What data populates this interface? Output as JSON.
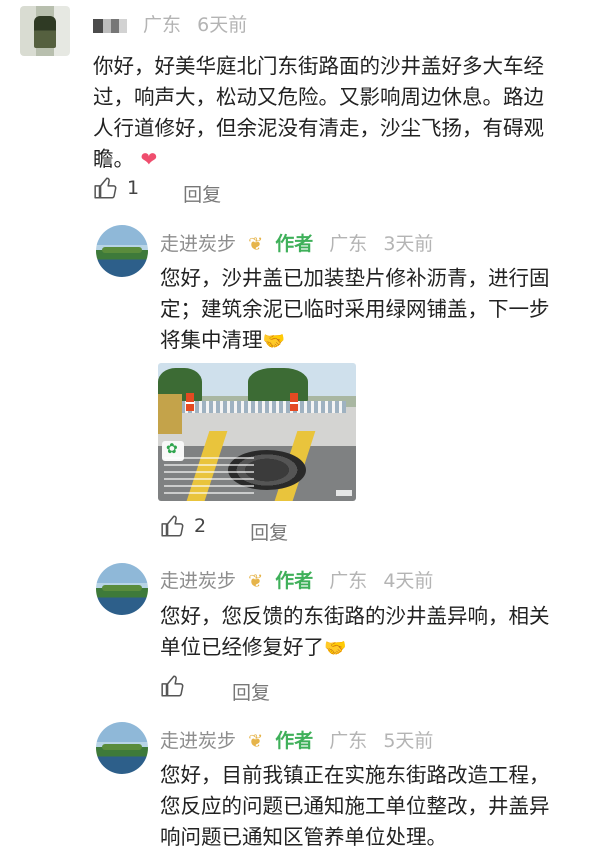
{
  "comments": [
    {
      "name": "",
      "region": "广东",
      "time": "6天前",
      "text_lines": [
        "你好，好美华庭北门东街路面的沙井盖好多大车经",
        "过，响声大，松动又危险。又影响周边休息。路边",
        "人行道修好，但余泥没有清走，沙尘飞扬，有碍观",
        "瞻。"
      ],
      "emoji": "❤",
      "likes": "1",
      "reply_label": "回复"
    },
    {
      "name": "走进炭步",
      "badge": "作者",
      "region": "广东",
      "time": "3天前",
      "text_lines": [
        "您好，沙井盖已加装垫片修补沥青，进行固",
        "定；建筑余泥已临时采用绿网铺盖，下一步",
        "将集中清理"
      ],
      "emoji": "🤝",
      "likes": "2",
      "reply_label": "回复"
    },
    {
      "name": "走进炭步",
      "badge": "作者",
      "region": "广东",
      "time": "4天前",
      "text_lines": [
        "您好，您反馈的东街路的沙井盖异响，相关",
        "单位已经修复好了"
      ],
      "emoji": "🤝",
      "likes": "",
      "reply_label": "回复"
    },
    {
      "name": "走进炭步",
      "badge": "作者",
      "region": "广东",
      "time": "5天前",
      "text_lines": [
        "您好，目前我镇正在实施东街路改造工程，",
        "您反应的问题已通知施工单位整改，井盖异",
        "响问题已通知区管养单位处理。"
      ]
    }
  ],
  "icons": {
    "like": "thumbs-up-icon",
    "badge": "heart-ribbon-icon",
    "heart": "heart-emoji-icon",
    "handshake": "handshake-emoji-icon"
  },
  "colors": {
    "author_green": "#3fb05a",
    "meta_gray": "#b4b4b4"
  }
}
